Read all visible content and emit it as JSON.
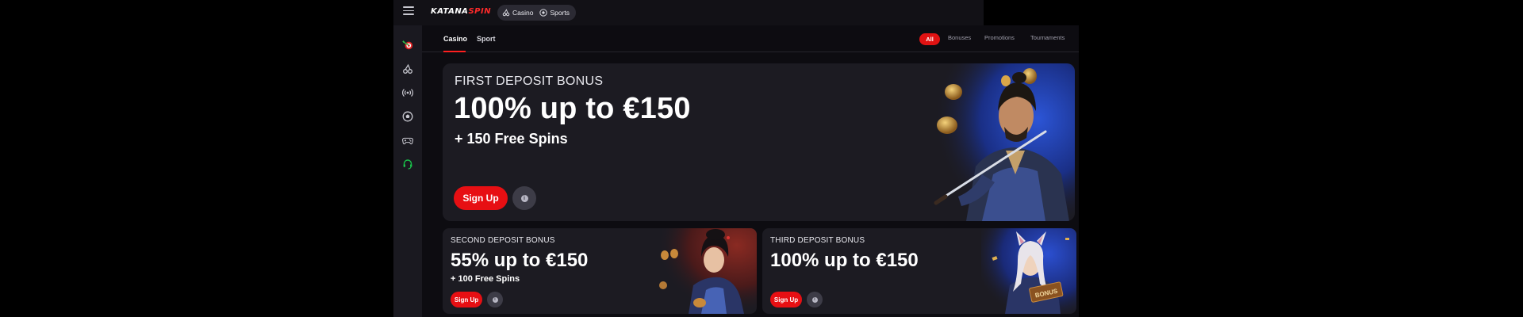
{
  "header": {
    "menu_icon": "hamburger-icon",
    "logo_part1": "KATANA",
    "logo_part2": "SPIN",
    "nav": [
      {
        "label": "Casino",
        "icon": "cherry-icon"
      },
      {
        "label": "Sports",
        "icon": "soccer-ball-icon"
      }
    ]
  },
  "sidebar": {
    "icons": [
      "darts-icon",
      "cherry-icon",
      "live-broadcast-icon",
      "soccer-ball-icon",
      "gamepad-icon",
      "headset-support-icon"
    ]
  },
  "tabs": [
    {
      "label": "Casino",
      "active": true
    },
    {
      "label": "Sport",
      "active": false
    }
  ],
  "filters": [
    {
      "label": "All",
      "active": true
    },
    {
      "label": "Bonuses",
      "active": false
    },
    {
      "label": "Promotions",
      "active": false
    },
    {
      "label": "Tournaments",
      "active": false
    }
  ],
  "hero": {
    "kicker": "FIRST DEPOSIT BONUS",
    "title": "100% up to €150",
    "subtitle": "+ 150 Free Spins",
    "button": "Sign Up",
    "info_icon": "info-icon"
  },
  "cards": [
    {
      "kicker": "SECOND DEPOSIT BONUS",
      "title": "55% up to €150",
      "subtitle": "+ 100 Free Spins",
      "button": "Sign Up",
      "info_icon": "info-icon"
    },
    {
      "kicker": "THIRD DEPOSIT BONUS",
      "title": "100% up to €150",
      "subtitle": "",
      "button": "Sign Up",
      "info_icon": "info-icon",
      "art_label": "BONUS"
    }
  ],
  "colors": {
    "accent": "#e70f13",
    "card_bg": "#1c1b22",
    "page_bg": "#0d0c11",
    "sidebar_bg": "#1a1920",
    "support_green": "#19c24a"
  }
}
